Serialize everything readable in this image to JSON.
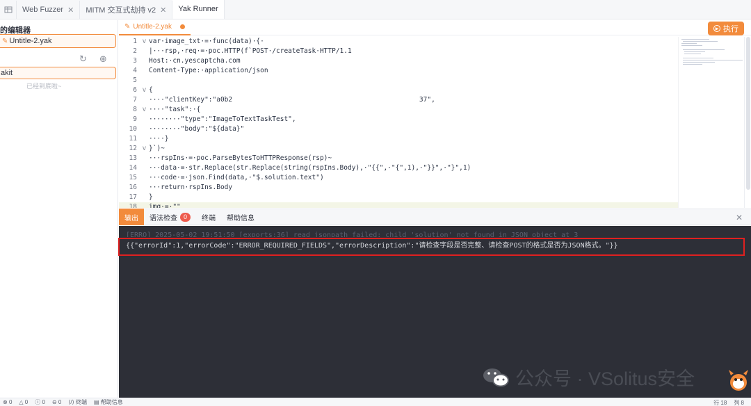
{
  "topbar": {
    "tabs": [
      {
        "label": "Web Fuzzer",
        "closable": true
      },
      {
        "label": "MITM 交互式劫持 v2",
        "closable": true
      },
      {
        "label": "Yak Runner",
        "closable": false
      }
    ]
  },
  "sidebar": {
    "title": "的编辑器",
    "file": "Untitle-2.yak",
    "kit": "akit",
    "hint": "已经到底啦~"
  },
  "editor": {
    "tab_label": "Untitle-2.yak",
    "run_label": "执行"
  },
  "code_lines": [
    {
      "n": "1",
      "fold": "v",
      "text": "var·image_txt·=·func(data)·{·"
    },
    {
      "n": "2",
      "fold": "",
      "text": "|···rsp,·req·=·poc.HTTP(f`POST·/createTask·HTTP/1.1"
    },
    {
      "n": "3",
      "fold": "",
      "text": "Host:·cn.yescaptcha.com"
    },
    {
      "n": "4",
      "fold": "",
      "text": "Content-Type:·application/json"
    },
    {
      "n": "5",
      "fold": "",
      "text": ""
    },
    {
      "n": "6",
      "fold": "v",
      "text": "{"
    },
    {
      "n": "7",
      "fold": "",
      "text": "····\"clientKey\":\"a0b2                                               37\","
    },
    {
      "n": "8",
      "fold": "v",
      "text": "····\"task\":·{"
    },
    {
      "n": "9",
      "fold": "",
      "text": "········\"type\":\"ImageToTextTaskTest\","
    },
    {
      "n": "10",
      "fold": "",
      "text": "········\"body\":\"${data}\""
    },
    {
      "n": "11",
      "fold": "",
      "text": "····}"
    },
    {
      "n": "12",
      "fold": "v",
      "text": "}`)~"
    },
    {
      "n": "13",
      "fold": "",
      "text": "···rspIns·=·poc.ParseBytesToHTTPResponse(rsp)~"
    },
    {
      "n": "14",
      "fold": "",
      "text": "···data·=·str.Replace(str.Replace(string(rspIns.Body),·\"{{\",·\"{\",1),·\"}}\",·\"}\",1)"
    },
    {
      "n": "15",
      "fold": "",
      "text": "···code·=·json.Find(data,·\"$.solution.text\")"
    },
    {
      "n": "16",
      "fold": "",
      "text": "···return·rspIns.Body"
    },
    {
      "n": "17",
      "fold": "",
      "text": "}"
    },
    {
      "n": "18",
      "fold": "",
      "text": "img·=·\"\""
    }
  ],
  "output": {
    "tabs": [
      {
        "label": "输出",
        "active": true
      },
      {
        "label": "语法检查",
        "badge": "0"
      },
      {
        "label": "终端"
      },
      {
        "label": "帮助信息"
      }
    ]
  },
  "terminal": {
    "line1": "[ERRO] 2025-05-02 19:51:50 [exports:36] read jsonpath failed: child 'solution' not found in JSON object at 3",
    "line2": "{{\"errorId\":1,\"errorCode\":\"ERROR_REQUIRED_FIELDS\",\"errorDescription\":\"请检查字段是否完整、请检查POST的格式是否为JSON格式。\"}}"
  },
  "statusbar": {
    "items": [
      "0",
      "0",
      "0",
      "0",
      "终端",
      "帮助信息"
    ],
    "right": [
      "行 18",
      "列 8"
    ]
  },
  "watermark": {
    "text": "公众号 · VSolitus安全"
  },
  "colors": {
    "accent": "#f28b3c",
    "terminal_bg": "#2d2f37",
    "highlight_box": "#e02020"
  }
}
